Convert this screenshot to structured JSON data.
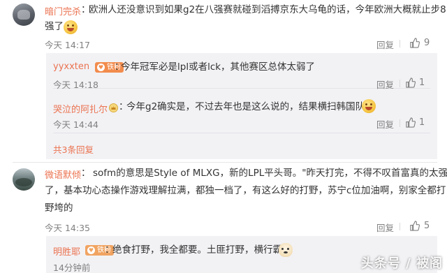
{
  "comments": [
    {
      "username": "暗门完杀",
      "separator": "：",
      "text_line1": "欧洲人还没意识到如果g2在八强赛就碰到滔搏京东大乌龟的话，今年欧洲大概就止步8",
      "text_line2": "强了",
      "time": "今天 14:17",
      "reply_label": "回复",
      "likes": "9"
    },
    {
      "username": "微语默倾",
      "separator": "：",
      "text_line1": "sofm的意思是Style of MLXG，新的LPL平头哥。\"昨天打完，不得不叹首富真的太强",
      "text_line2": "了，基本功心态操作游戏理解拉满，都独一档了，有这么好的打野，苏宁c位加油啊，别家全都打",
      "text_line3": "野垮的",
      "time": "今天 14:35",
      "reply_label": "回复",
      "likes": "5"
    }
  ],
  "replies_group1": [
    {
      "username": "yyxxten",
      "badge": "铁粉",
      "separator": "：",
      "text": "今年冠军必是lpl或者lck，其他赛区总体太弱了",
      "time": "今天 14:18",
      "reply_label": "回复",
      "likes": "1"
    },
    {
      "username": "哭泣的阿扎尔",
      "separator": "：",
      "text": "今年g2确实是，不过去年也是这么说的，结果横扫韩国队伍",
      "time": "今天 14:44",
      "reply_label": "回复",
      "likes": "1"
    }
  ],
  "more_replies": "共3条回复",
  "replies_group2": [
    {
      "username": "明胜耶",
      "badge": "铁粉",
      "separator": "：",
      "text": "绝食打野，我全都要。土匪打野，横行霸道",
      "time": "14分钟前"
    }
  ],
  "watermark": "头条号 / 被阁"
}
